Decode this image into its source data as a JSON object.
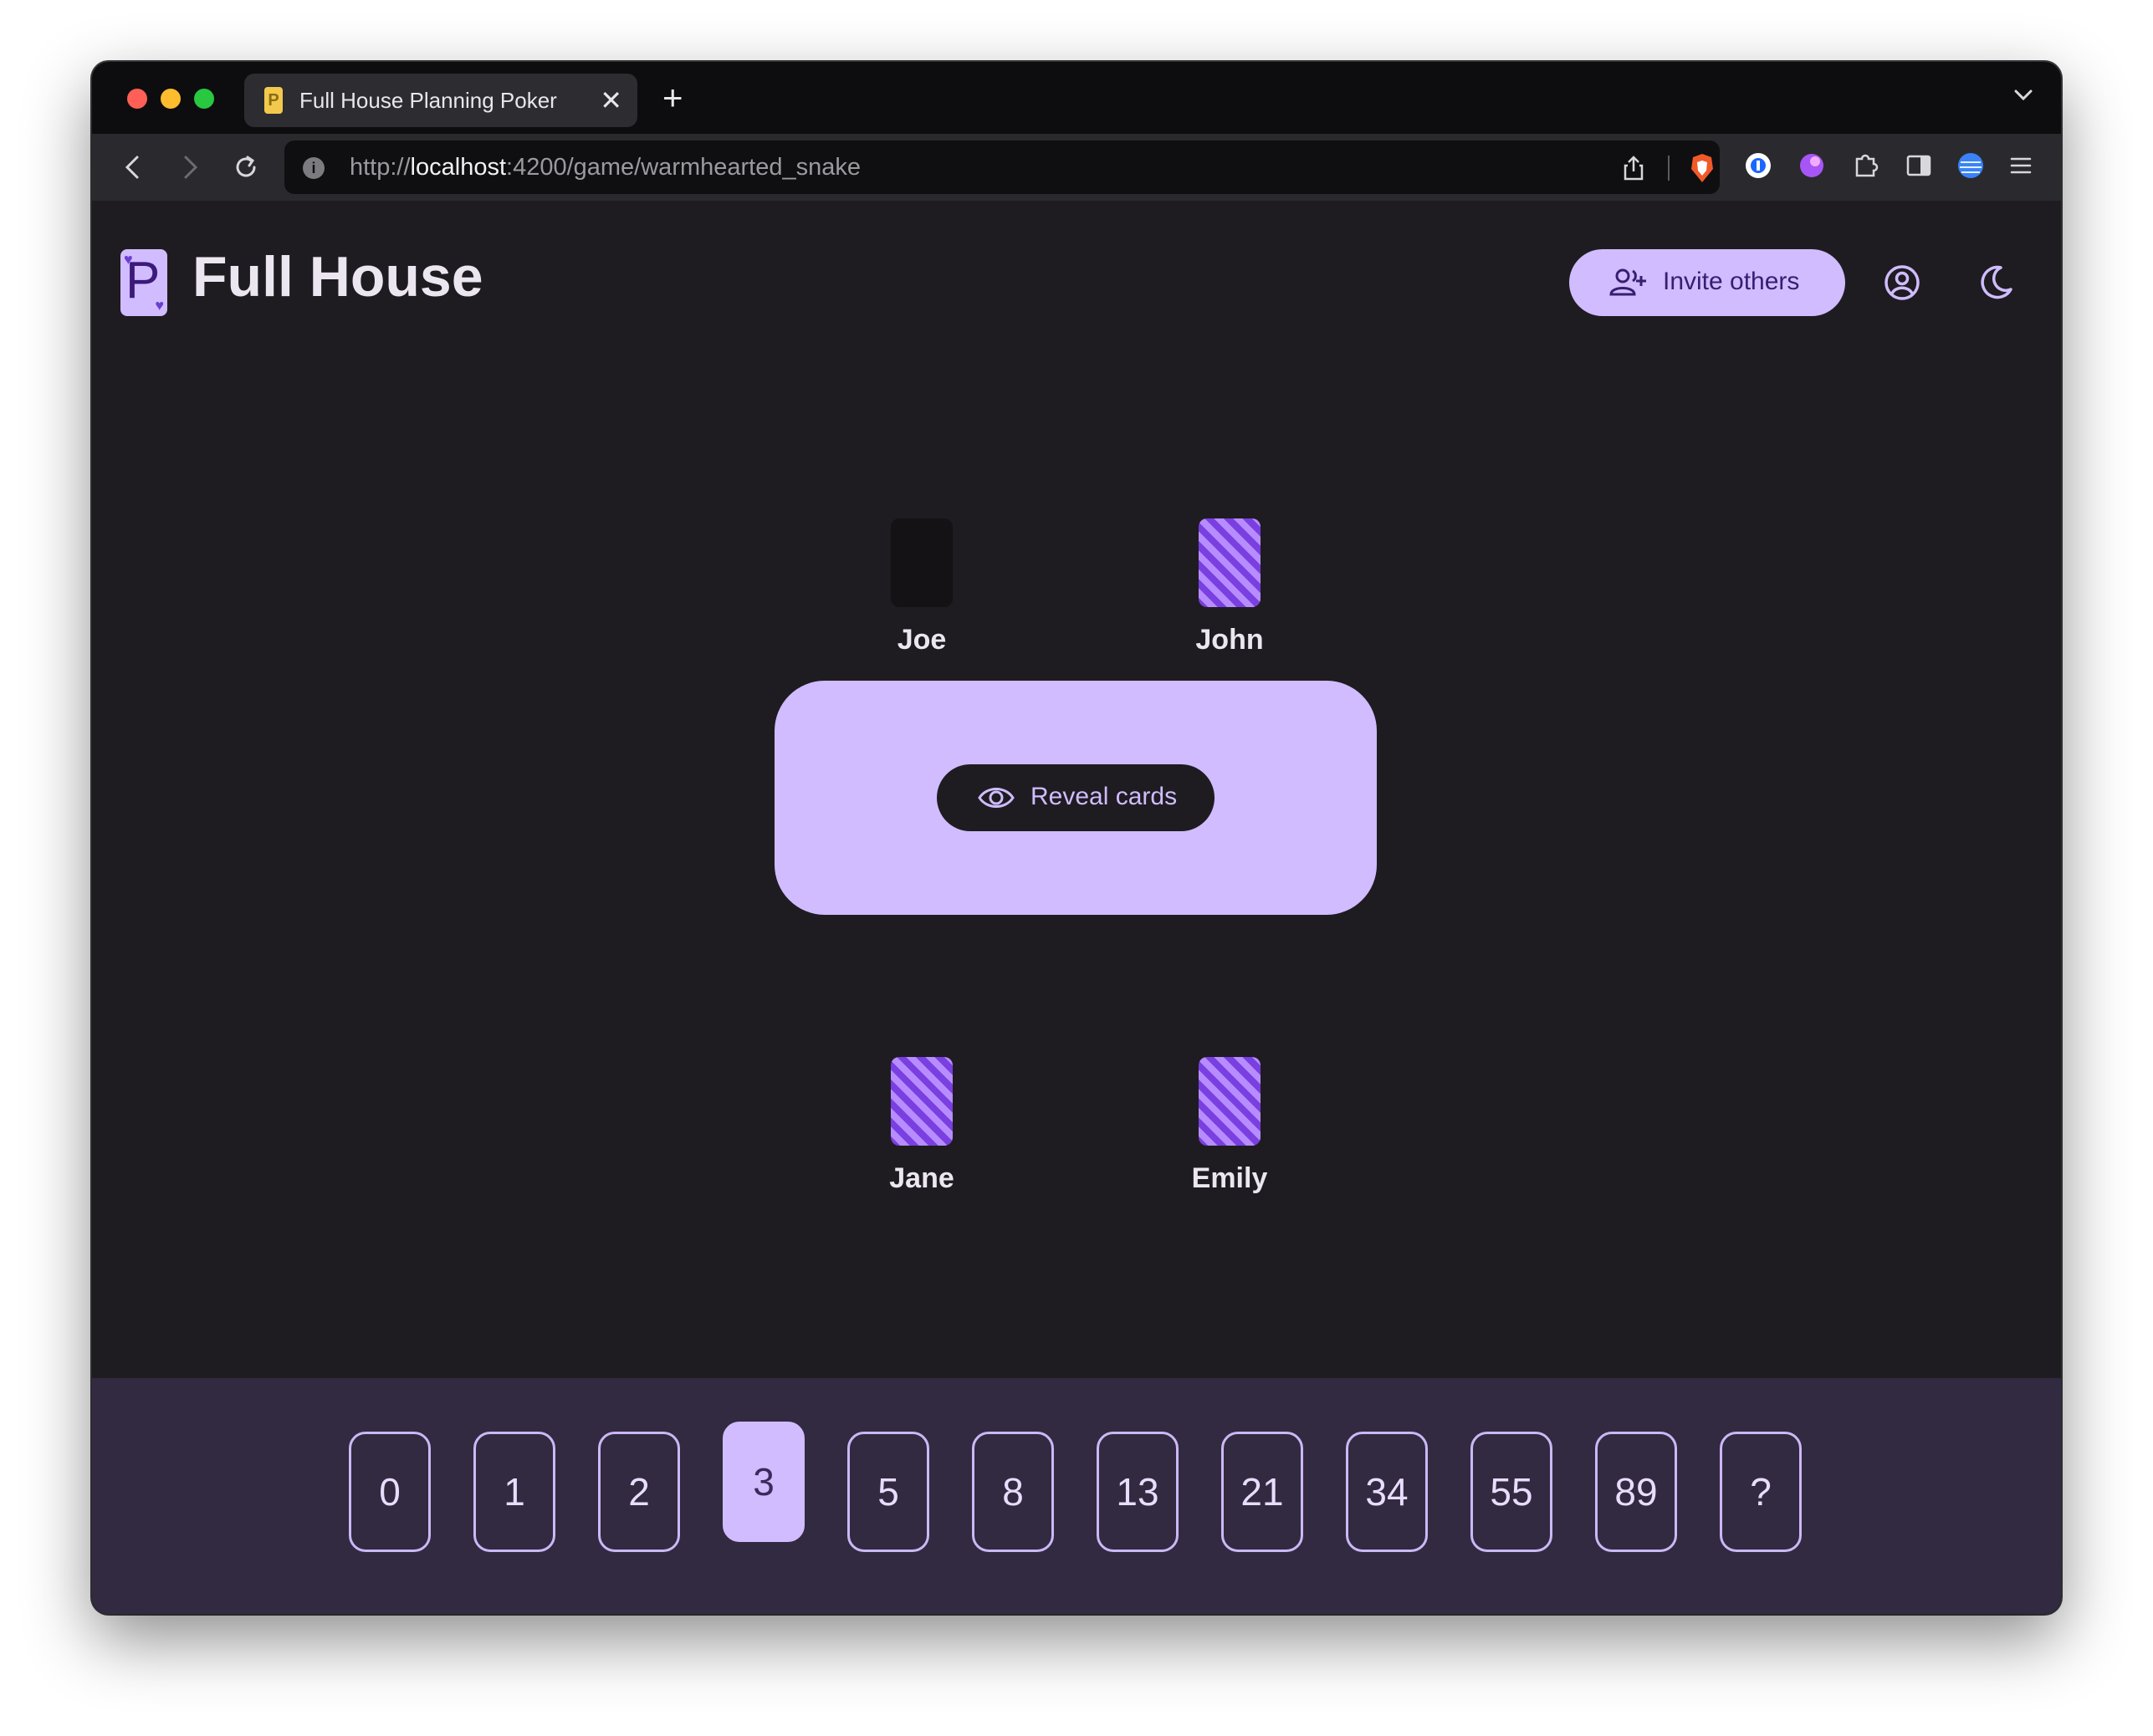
{
  "browser": {
    "tab_title": "Full House Planning Poker",
    "tab_close": "✕",
    "new_tab": "+",
    "url_scheme": "http://",
    "url_host": "localhost",
    "url_rest": ":4200/game/warmhearted_snake",
    "traffic_lights": {
      "close": "#ff5f57",
      "minimize": "#febc2e",
      "zoom": "#28c840"
    }
  },
  "app": {
    "logo_letter": "P",
    "logo_suit": "♥",
    "title": "Full House",
    "invite_label": "Invite others",
    "accent": "#d0bcff"
  },
  "players": [
    {
      "name": "Joe",
      "card": "empty"
    },
    {
      "name": "John",
      "card": "face-down"
    },
    {
      "name": "Jane",
      "card": "face-down"
    },
    {
      "name": "Emily",
      "card": "face-down"
    }
  ],
  "table": {
    "reveal_label": "Reveal cards"
  },
  "deck": {
    "cards": [
      "0",
      "1",
      "2",
      "3",
      "5",
      "8",
      "13",
      "21",
      "34",
      "55",
      "89",
      "?"
    ],
    "selected": "3"
  }
}
